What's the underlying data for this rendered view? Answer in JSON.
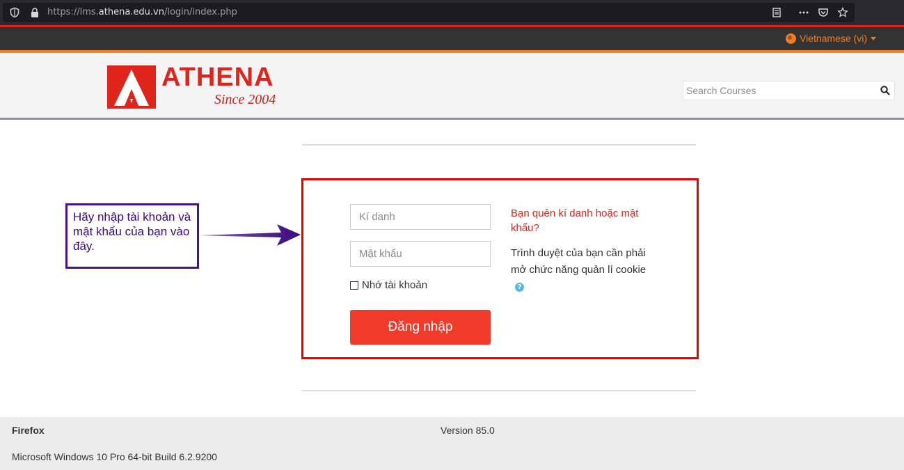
{
  "browser": {
    "url_prefix": "https://lms.",
    "url_host": "athena.edu.vn",
    "url_path": "/login/index.php"
  },
  "topnav": {
    "language": "Vietnamese (vi)"
  },
  "header": {
    "logo_word": "ATHENA",
    "logo_since": "Since 2004",
    "search_placeholder": "Search Courses"
  },
  "login": {
    "username_placeholder": "Kí danh",
    "password_placeholder": "Mật khẩu",
    "remember_label": "Nhớ tài khoản",
    "login_button": "Đăng nhập",
    "forgot_link": "Bạn quên kí danh hoặc mật khẩu?",
    "cookie_note": "Trình duyệt của bạn cần phải mở chức năng quản lí cookie"
  },
  "annotation": {
    "text": "Hãy nhập tài khoản và mật khẩu của bạn vào đây."
  },
  "footer": {
    "browser_name": "Firefox",
    "version": "Version 85.0",
    "os": "Microsoft Windows 10 Pro 64-bit Build 6.2.9200"
  },
  "colors": {
    "accent_orange": "#f57c1f",
    "brand_red": "#e0241c",
    "login_button": "#f13a2a",
    "annotation_purple": "#4b1282"
  },
  "icons": [
    "shield-icon",
    "lock-icon",
    "reader-view-icon",
    "more-icon",
    "pocket-icon",
    "bookmark-star-icon",
    "globe-icon",
    "search-icon",
    "help-icon"
  ]
}
